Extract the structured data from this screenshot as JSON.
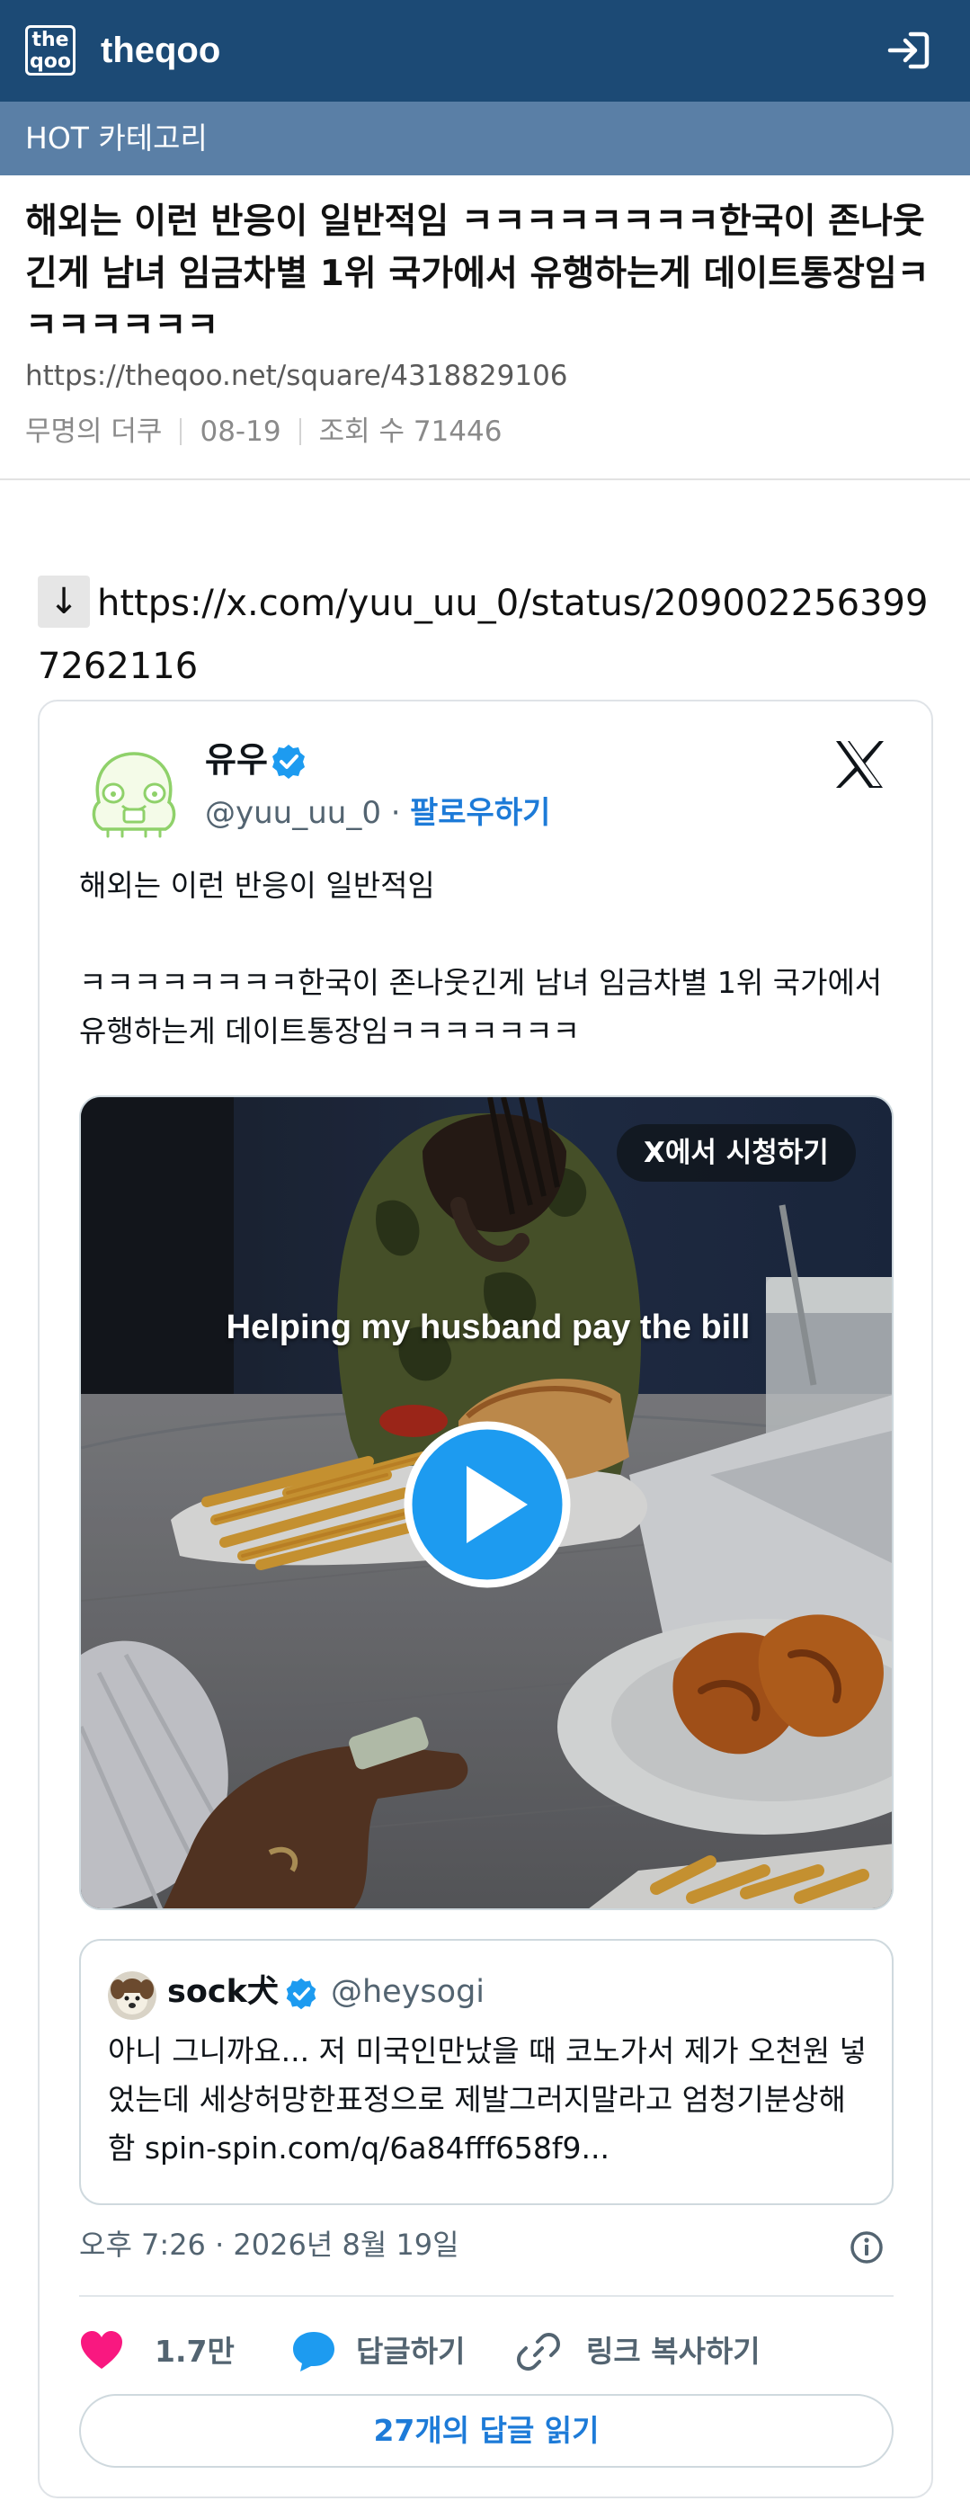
{
  "header": {
    "logo_line1": "the",
    "logo_line2": "qoo",
    "site_name": "theqoo",
    "login_icon": "login-arrow-icon"
  },
  "category": {
    "label": "HOT 카테고리"
  },
  "post": {
    "title": "해외는 이런 반응이 일반적임 ㅋㅋㅋㅋㅋㅋㅋㅋ한국이 존나웃긴게 남녀 임금차별 1위 국가에서 유행하는게 데이트통장임ㅋㅋㅋㅋㅋㅋㅋ",
    "url": "https://theqoo.net/square/4318829106",
    "author": "무명의 더쿠",
    "date": "08-19",
    "views": "조회 수 71446"
  },
  "body": {
    "arrow": "↓",
    "link": "https://x.com/yuu_uu_0/status/2090022563997262116"
  },
  "tweet": {
    "author_name": "유우",
    "handle": "@yuu_uu_0",
    "handle_sep": " · ",
    "follow_label": "팔로우하기",
    "text": "해외는 이런 반응이 일반적임\n\nㅋㅋㅋㅋㅋㅋㅋㅋ한국이 존나웃긴게 남녀 임금차별 1위 국가에서 유행하는게 데이트통장임ㅋㅋㅋㅋㅋㅋㅋ",
    "media": {
      "watch_label": "X에서 시청하기",
      "caption": "Helping my husband pay the bill"
    },
    "quote": {
      "author_name": "sock犬",
      "handle": "@heysogi",
      "text": "아니 그니까요... 저 미국인만났을 때 코노가서 제가 오천원 넣었는데 세상허망한표정으로 제발그러지말라고 엄청기분상해함 spin-spin.com/q/6a84fff658f9..."
    },
    "timestamp": "오후 7:26 · 2026년 8월 19일",
    "likes": "1.7만",
    "reply_label": "답글하기",
    "copy_label": "링크 복사하기",
    "read_replies_label": "27개의 답글 읽기"
  },
  "colors": {
    "header_bg": "#1c4a75",
    "category_bg": "#5a7fa6",
    "x_blue": "#1d9bf0",
    "like_pink": "#f91880",
    "link_blue": "#1d7bd8"
  }
}
